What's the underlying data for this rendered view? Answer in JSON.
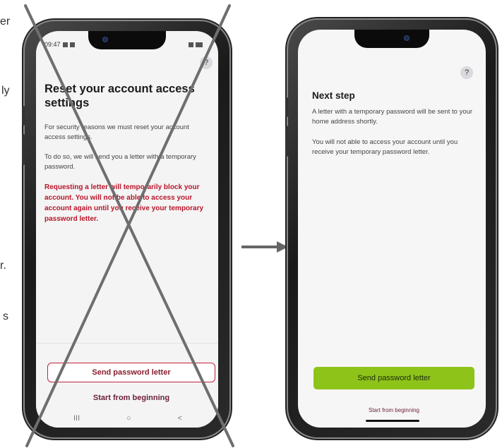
{
  "edge_text": [
    "er",
    "ly",
    "r.",
    "s"
  ],
  "left_phone": {
    "status_time": "09:47",
    "help_label": "?",
    "title": "Reset your account access settings",
    "paragraph_1": "For security reasons we must reset your account access settings.",
    "paragraph_2": "To do so, we will send you a letter with a temporary password.",
    "warning": "Requesting a letter will temporarily block your account. You will not be able to access your account again until you receive your temporary password letter.",
    "send_button_label": "Send password letter",
    "restart_link": "Start from beginning",
    "nav_recents": "III",
    "nav_home": "○",
    "nav_back": "<"
  },
  "right_phone": {
    "help_label": "?",
    "title": "Next step",
    "paragraph_1": "A letter with a temporary password will be sent to your home address shortly.",
    "paragraph_2": "You will not able to access your account until you receive your temporary password letter.",
    "send_button_label": "Send password letter",
    "restart_link": "Start from beginning"
  },
  "colors": {
    "warning_red": "#b8152a",
    "primary_green": "#8ec31a",
    "link_maroon": "#6b1e3a",
    "cross_gray": "#6e6e6e",
    "arrow_gray": "#666666"
  },
  "icons": {
    "flow_arrow": "arrow-right-icon",
    "rejected_mark": "cross-x-icon"
  }
}
